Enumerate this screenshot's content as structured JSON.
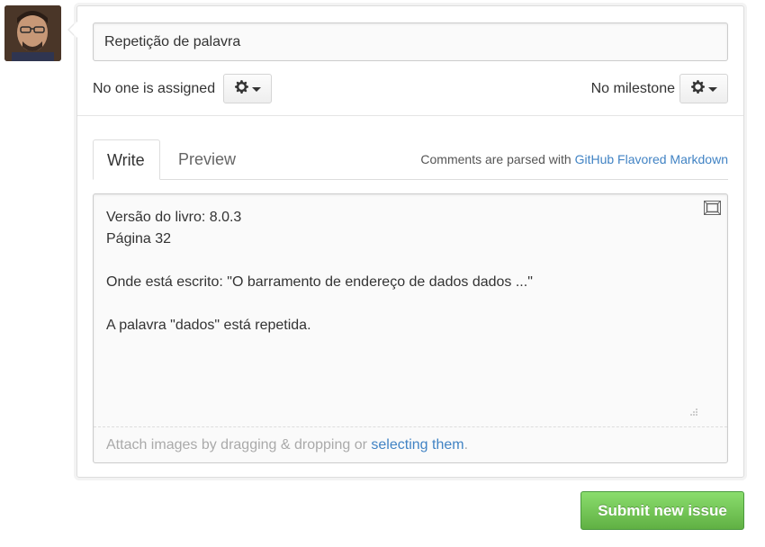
{
  "issue": {
    "title_value": "Repetição de palavra",
    "assignee_text": "No one is assigned",
    "milestone_text": "No milestone"
  },
  "tabs": [
    {
      "label": "Write",
      "active": true
    },
    {
      "label": "Preview",
      "active": false
    }
  ],
  "markdown_note": {
    "prefix": "Comments are parsed with ",
    "link": "GitHub Flavored Markdown"
  },
  "editor": {
    "lines": [
      "Versão do livro: 8.0.3",
      "Página 32",
      "",
      "Onde está escrito: \"O barramento de endereço de dados dados ...\"",
      "",
      "A palavra \"dados\" está repetida."
    ]
  },
  "attach": {
    "prefix": "Attach images by dragging & dropping or ",
    "link": "selecting them",
    "suffix": "."
  },
  "submit_label": "Submit new issue",
  "icons": {
    "assignee_gear": "gear-icon",
    "milestone_gear": "gear-icon",
    "fullscreen": "fullscreen-icon",
    "resize": "resize-handle-icon"
  },
  "colors": {
    "link": "#4183c4",
    "submit_green": "#60b044"
  }
}
